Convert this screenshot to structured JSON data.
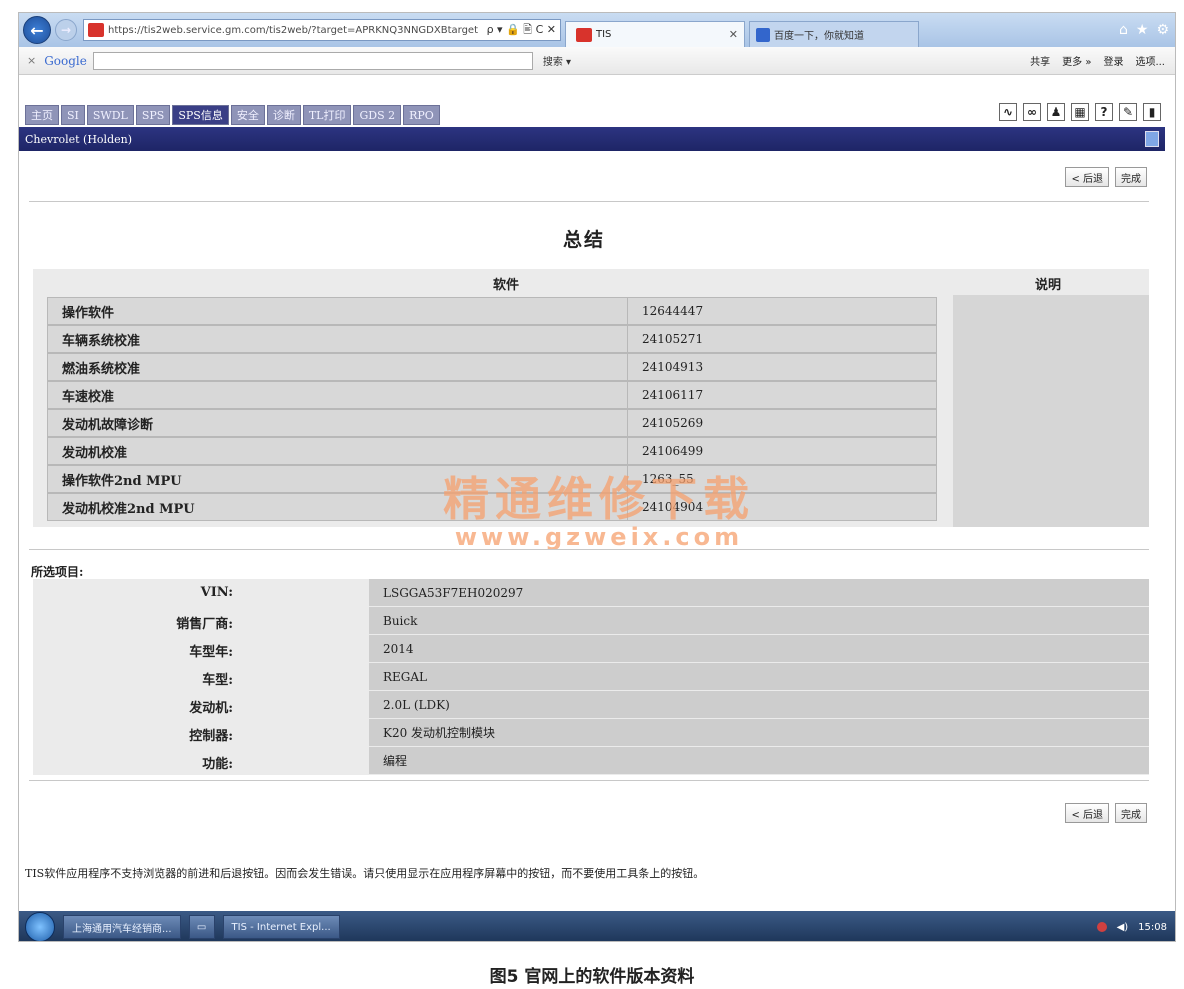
{
  "browser": {
    "url": "https://tis2web.service.gm.com/tis2web/?target=APRKNQ3NNGDXBtarget",
    "addr_tools": "ρ ▾ 🔒 🖹 C ✕",
    "tabs": [
      {
        "label": "TIS",
        "active": true
      },
      {
        "label": "百度一下，你就知道",
        "active": false
      }
    ],
    "window_icons": [
      "⌂",
      "★",
      "⚙"
    ]
  },
  "google_toolbar": {
    "logo": "Google",
    "search_label": "搜索 ▾",
    "right_items": [
      "共享",
      "更多 »",
      "登录",
      "选项..."
    ]
  },
  "app": {
    "tabs": [
      {
        "label": "主页",
        "active": false
      },
      {
        "label": "SI",
        "active": false
      },
      {
        "label": "SWDL",
        "active": false
      },
      {
        "label": "SPS",
        "active": false
      },
      {
        "label": "SPS信息",
        "active": true
      },
      {
        "label": "安全",
        "active": false
      },
      {
        "label": "诊断",
        "active": false
      },
      {
        "label": "TL打印",
        "active": false
      },
      {
        "label": "GDS 2",
        "active": false
      },
      {
        "label": "RPO",
        "active": false
      }
    ],
    "toolbar_icons": [
      {
        "name": "chart-icon",
        "glyph": "∿"
      },
      {
        "name": "link-icon",
        "glyph": "∞"
      },
      {
        "name": "user-icon",
        "glyph": "♟"
      },
      {
        "name": "calculator-icon",
        "glyph": "▦"
      },
      {
        "name": "help-icon",
        "glyph": "?"
      },
      {
        "name": "note-icon",
        "glyph": "✎"
      },
      {
        "name": "book-icon",
        "glyph": "▮"
      }
    ],
    "brand_bar": "Chevrolet (Holden)",
    "back_button": "< 后退",
    "finish_button": "完成",
    "title": "总结",
    "software_header": "软件",
    "notes_header": "说明",
    "software_rows": [
      {
        "name": "操作软件",
        "value": "12644447"
      },
      {
        "name": "车辆系统校准",
        "value": "24105271"
      },
      {
        "name": "燃油系统校准",
        "value": "24104913"
      },
      {
        "name": "车速校准",
        "value": "24106117"
      },
      {
        "name": "发动机故障诊断",
        "value": "24105269"
      },
      {
        "name": "发动机校准",
        "value": "24106499"
      },
      {
        "name": "操作软件2nd MPU",
        "value": "1263_55"
      },
      {
        "name": "发动机校准2nd MPU",
        "value": "24104904"
      }
    ],
    "selected_heading": "所选项目:",
    "selected_items": [
      {
        "label": "VIN:",
        "value": "LSGGA53F7EH020297"
      },
      {
        "label": "销售厂商:",
        "value": "Buick"
      },
      {
        "label": "车型年:",
        "value": "2014"
      },
      {
        "label": "车型:",
        "value": "REGAL"
      },
      {
        "label": "发动机:",
        "value": "2.0L (LDK)"
      },
      {
        "label": "控制器:",
        "value": "K20 发动机控制模块"
      },
      {
        "label": "功能:",
        "value": "编程"
      }
    ],
    "footer_note": "TIS软件应用程序不支持浏览器的前进和后退按钮。因而会发生错误。请只使用显示在应用程序屏幕中的按钮，而不要使用工具条上的按钮。"
  },
  "watermark": {
    "text": "精通维修下载",
    "url": "www.gzweix.com"
  },
  "taskbar": {
    "items": [
      "上海通用汽车经销商...",
      "TIS - Internet Expl..."
    ],
    "time": "15:08"
  },
  "caption": "图5 官网上的软件版本资料"
}
